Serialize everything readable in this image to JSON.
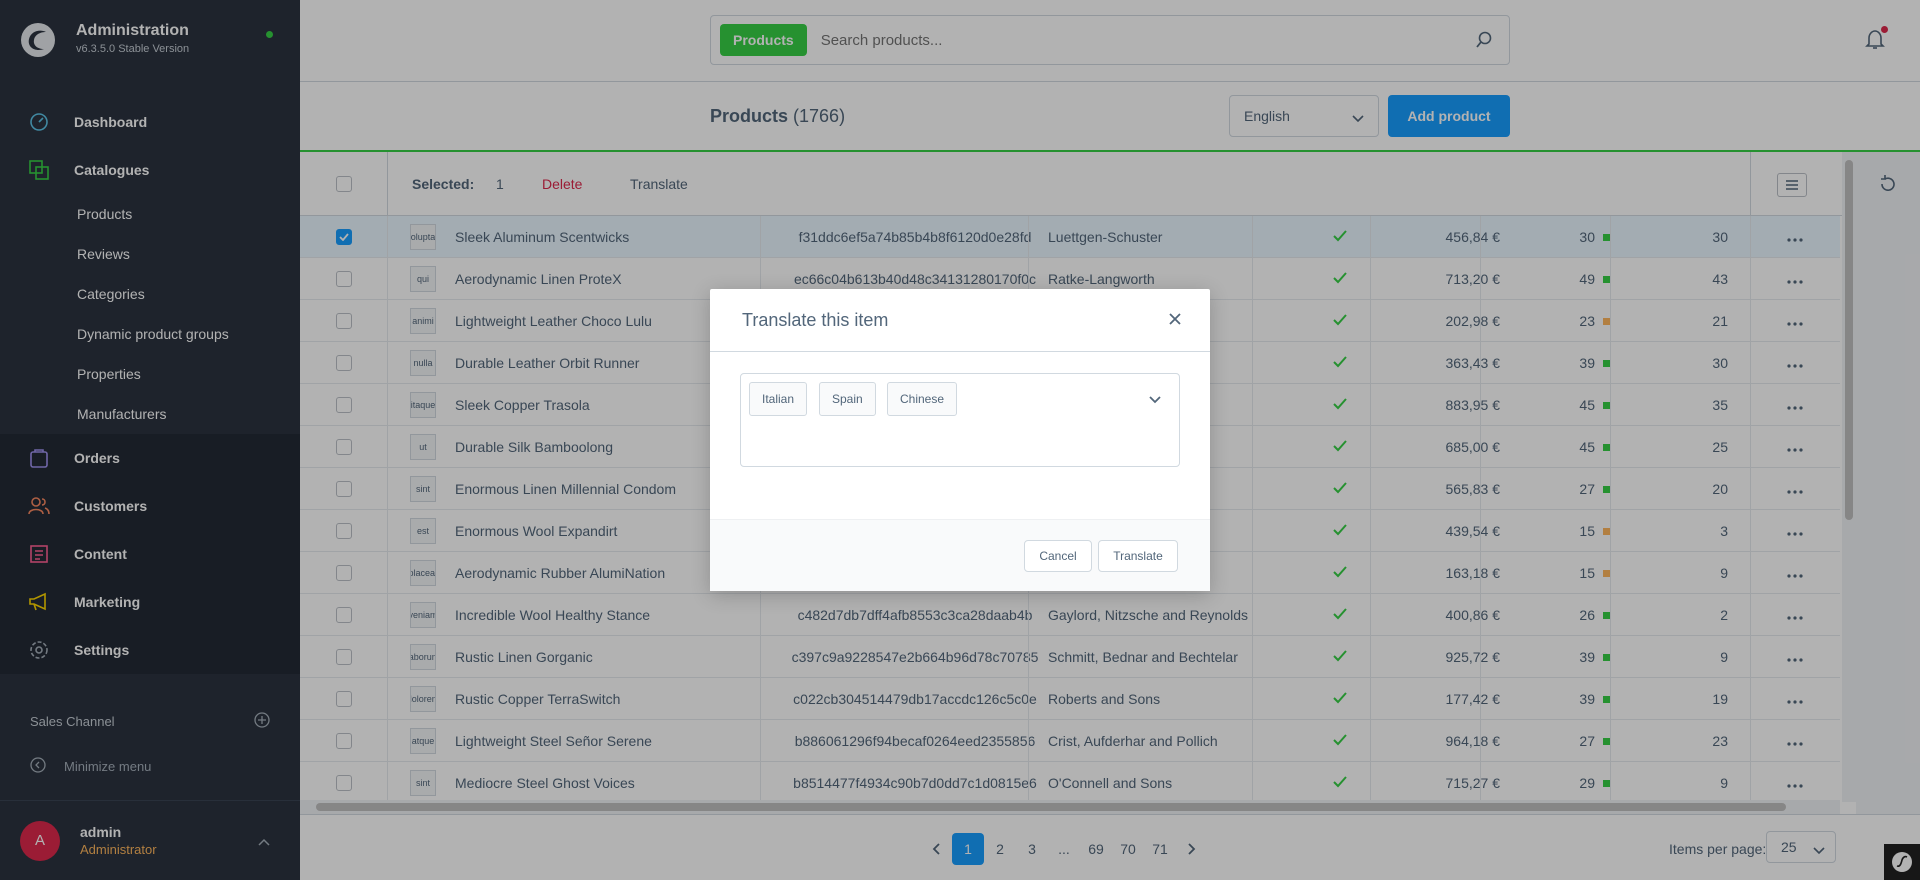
{
  "app": {
    "title": "Administration",
    "version": "v6.3.5.0 Stable Version"
  },
  "nav": {
    "dashboard": "Dashboard",
    "catalogues": "Catalogues",
    "sub": [
      "Products",
      "Reviews",
      "Categories",
      "Dynamic product groups",
      "Properties",
      "Manufacturers"
    ],
    "orders": "Orders",
    "customers": "Customers",
    "content": "Content",
    "marketing": "Marketing",
    "settings": "Settings",
    "sales_channel": "Sales Channel",
    "minimize": "Minimize menu"
  },
  "user": {
    "initial": "A",
    "name": "admin",
    "role": "Administrator"
  },
  "search": {
    "tag": "Products",
    "placeholder": "Search products..."
  },
  "header": {
    "title": "Products",
    "count": "(1766)",
    "language": "English",
    "add_label": "Add product"
  },
  "bulk": {
    "selected_label": "Selected:",
    "selected_count": "1",
    "delete": "Delete",
    "translate": "Translate"
  },
  "rows": [
    {
      "thumb": "voluptas",
      "name": "Sleek Aluminum Scentwicks",
      "number": "f31ddc6ef5a74b85b4b8f6120d0e28fd",
      "manufacturer": "Luettgen-Schuster",
      "price": "456,84 €",
      "stock": "30",
      "stock_status": "green",
      "available": "30",
      "selected": true
    },
    {
      "thumb": "qui",
      "name": "Aerodynamic Linen ProteX",
      "number": "ec66c04b613b40d48c34131280170f0c",
      "manufacturer": "Ratke-Langworth",
      "price": "713,20 €",
      "stock": "49",
      "stock_status": "green",
      "available": "43",
      "selected": false
    },
    {
      "thumb": "animi",
      "name": "Lightweight Leather Choco Lulu",
      "number": "",
      "manufacturer": "",
      "price": "202,98 €",
      "stock": "23",
      "stock_status": "orange",
      "available": "21",
      "selected": false
    },
    {
      "thumb": "nulla",
      "name": "Durable Leather Orbit Runner",
      "number": "",
      "manufacturer": "",
      "price": "363,43 €",
      "stock": "39",
      "stock_status": "green",
      "available": "30",
      "selected": false
    },
    {
      "thumb": "itaque",
      "name": "Sleek Copper Trasola",
      "number": "",
      "manufacturer": "",
      "price": "883,95 €",
      "stock": "45",
      "stock_status": "green",
      "available": "35",
      "selected": false
    },
    {
      "thumb": "ut",
      "name": "Durable Silk Bamboolong",
      "number": "",
      "manufacturer": "",
      "price": "685,00 €",
      "stock": "45",
      "stock_status": "green",
      "available": "25",
      "selected": false
    },
    {
      "thumb": "sint",
      "name": "Enormous Linen Millennial Condom",
      "number": "",
      "manufacturer": "",
      "price": "565,83 €",
      "stock": "27",
      "stock_status": "green",
      "available": "20",
      "selected": false
    },
    {
      "thumb": "est",
      "name": "Enormous Wool Expandirt",
      "number": "",
      "manufacturer": "",
      "price": "439,54 €",
      "stock": "15",
      "stock_status": "orange",
      "available": "3",
      "selected": false
    },
    {
      "thumb": "placeat",
      "name": "Aerodynamic Rubber AlumiNation",
      "number": "",
      "manufacturer": "",
      "price": "163,18 €",
      "stock": "15",
      "stock_status": "orange",
      "available": "9",
      "selected": false
    },
    {
      "thumb": "veniam",
      "name": "Incredible Wool Healthy Stance",
      "number": "c482d7db7dff4afb8553c3ca28daab4b",
      "manufacturer": "Gaylord, Nitzsche and Reynolds",
      "price": "400,86 €",
      "stock": "26",
      "stock_status": "green",
      "available": "2",
      "selected": false
    },
    {
      "thumb": "laborum",
      "name": "Rustic Linen Gorganic",
      "number": "c397c9a9228547e2b664b96d78c70785",
      "manufacturer": "Schmitt, Bednar and Bechtelar",
      "price": "925,72 €",
      "stock": "39",
      "stock_status": "green",
      "available": "9",
      "selected": false
    },
    {
      "thumb": "dolorem",
      "name": "Rustic Copper TerraSwitch",
      "number": "c022cb304514479db17accdc126c5c0e",
      "manufacturer": "Roberts and Sons",
      "price": "177,42 €",
      "stock": "39",
      "stock_status": "green",
      "available": "19",
      "selected": false
    },
    {
      "thumb": "atque",
      "name": "Lightweight Steel Señor Serene",
      "number": "b886061296f94becaf0264eed2355856",
      "manufacturer": "Crist, Aufderhar and Pollich",
      "price": "964,18 €",
      "stock": "27",
      "stock_status": "green",
      "available": "23",
      "selected": false
    },
    {
      "thumb": "sint",
      "name": "Mediocre Steel Ghost Voices",
      "number": "b8514477f4934c90b7d0dd7c1d0815e6",
      "manufacturer": "O'Connell and Sons",
      "price": "715,27 €",
      "stock": "29",
      "stock_status": "green",
      "available": "9",
      "selected": false
    }
  ],
  "colors": {
    "green": "#37d046",
    "orange": "#ffb75d",
    "accent": "#189eff",
    "danger": "#de294c"
  },
  "pagination": {
    "pages": [
      "1",
      "2",
      "3",
      "...",
      "69",
      "70",
      "71"
    ],
    "active": "1",
    "per_page_label": "Items per page:",
    "per_page": "25"
  },
  "modal": {
    "title": "Translate this item",
    "languages": [
      "Italian",
      "Spain",
      "Chinese"
    ],
    "cancel": "Cancel",
    "translate": "Translate"
  }
}
